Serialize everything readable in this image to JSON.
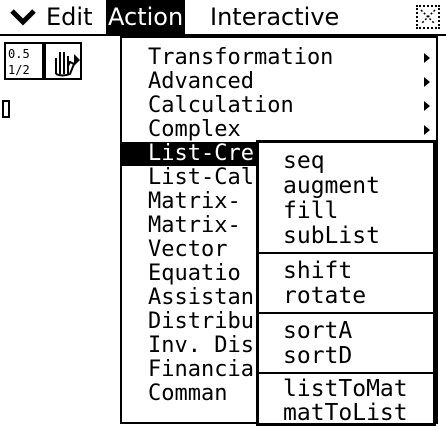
{
  "menubar": {
    "items": [
      "Edit",
      "Action",
      "Interactive"
    ],
    "selected": "Action"
  },
  "action_menu": {
    "items": [
      {
        "label": "Transformation",
        "submenu": true
      },
      {
        "label": "Advanced",
        "submenu": true
      },
      {
        "label": "Calculation",
        "submenu": true
      },
      {
        "label": "Complex",
        "submenu": true
      },
      {
        "label": "List-Cre",
        "submenu": true,
        "selected": true
      },
      {
        "label": "List-Cal",
        "submenu": false
      },
      {
        "label": "Matrix-",
        "submenu": false
      },
      {
        "label": "Matrix-",
        "submenu": false
      },
      {
        "label": "Vector",
        "submenu": false
      },
      {
        "label": "Equatio",
        "submenu": false
      },
      {
        "label": "Assistan",
        "submenu": false
      },
      {
        "label": "Distribu",
        "submenu": false
      },
      {
        "label": "Inv. Dis",
        "submenu": false
      },
      {
        "label": "Financia",
        "submenu": false
      },
      {
        "label": "Comman",
        "submenu": false
      }
    ]
  },
  "list_create_submenu": {
    "groups": [
      [
        "seq",
        "augment",
        "fill",
        "subList"
      ],
      [
        "shift",
        "rotate"
      ],
      [
        "sortA",
        "sortD"
      ],
      [
        "listToMat",
        "matToList"
      ]
    ]
  },
  "toolbar": {
    "fraction_button": {
      "top": "0.5",
      "bottom": "1/2"
    }
  },
  "icons": [
    "menu-chevron-icon",
    "close-icon",
    "fraction-decimal-icon",
    "stylus-hand-icon",
    "play-icon",
    "submenu-arrow-icon"
  ]
}
